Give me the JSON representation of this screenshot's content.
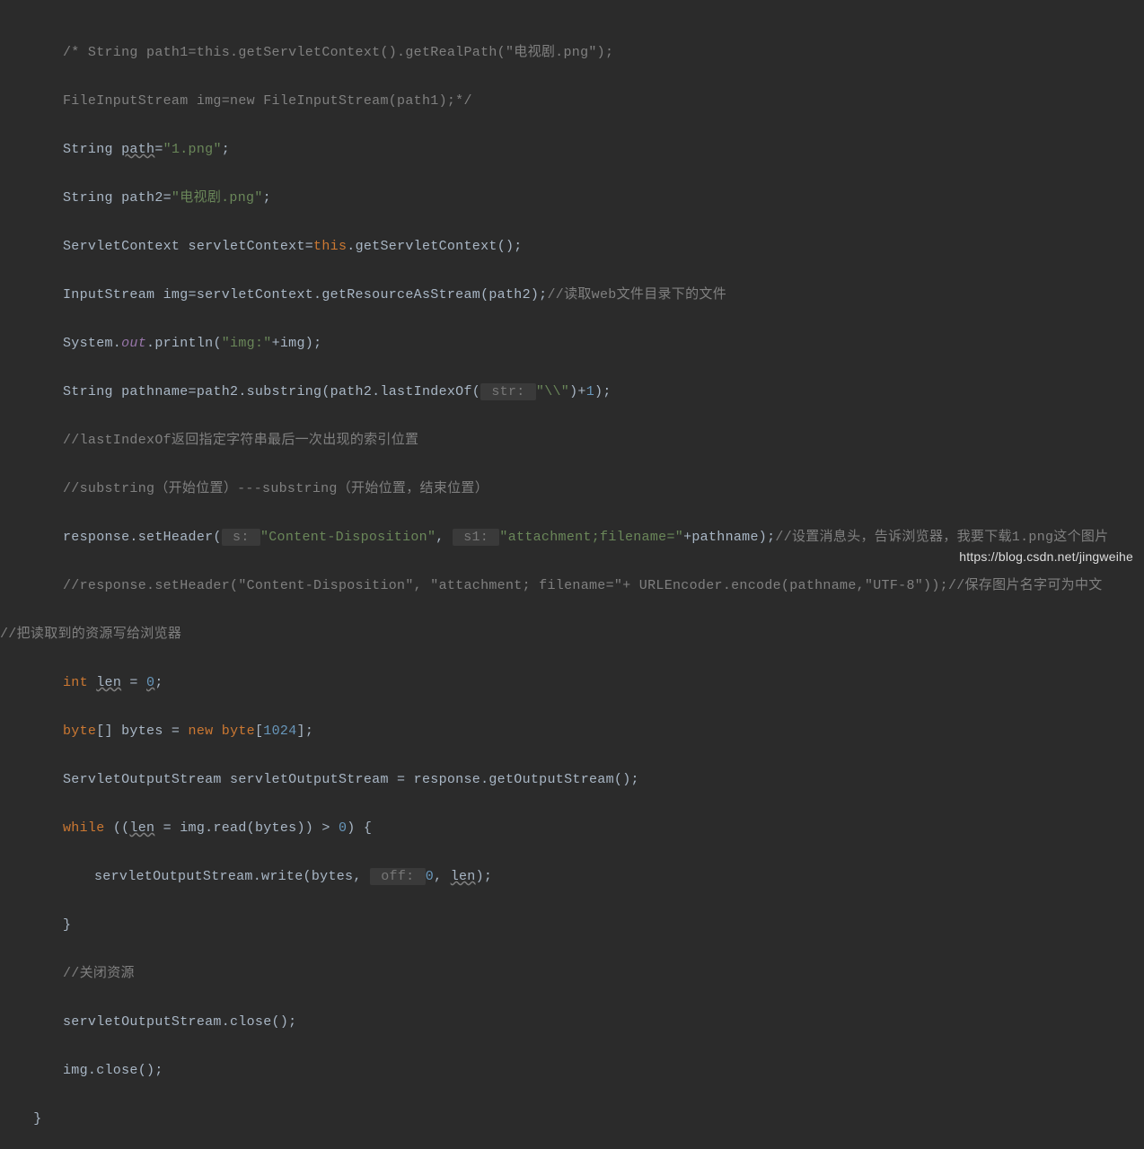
{
  "code": {
    "l1": "/* String path1=this.getServletContext().getRealPath(\"电视剧.png\");",
    "l2": "FileInputStream img=new FileInputStream(path1);*/",
    "l3_a": "String ",
    "l3_b": "path",
    "l3_c": "=",
    "l3_d": "\"1.png\"",
    "l3_e": ";",
    "l4_a": "String path2=",
    "l4_b": "\"电视剧.png\"",
    "l4_c": ";",
    "l5_a": "ServletContext servletContext=",
    "l5_b": "this",
    "l5_c": ".getServletContext();",
    "l6_a": "InputStream img=servletContext.getResourceAsStream(path2);",
    "l6_b": "//读取web文件目录下的文件",
    "l7_a": "System.",
    "l7_b": "out",
    "l7_c": ".println(",
    "l7_d": "\"img:\"",
    "l7_e": "+img);",
    "l8_a": "String pathname=path2.substring(path2.lastIndexOf(",
    "l8_hint": " str: ",
    "l8_b": "\"\\\\\"",
    "l8_c": ")+",
    "l8_d": "1",
    "l8_e": ");",
    "l9": "//lastIndexOf返回指定字符串最后一次出现的索引位置",
    "l10": "//substring（开始位置）---substring（开始位置，结束位置）",
    "l11_a": "response.setHeader(",
    "l11_h1": " s: ",
    "l11_b": "\"Content-Disposition\"",
    "l11_c": ", ",
    "l11_h2": " s1: ",
    "l11_d": "\"attachment;filename=\"",
    "l11_e": "+pathname);",
    "l11_f": "//设置消息头，告诉浏览器，我要下载1.png这个图片",
    "l12": "//response.setHeader(\"Content-Disposition\", \"attachment; filename=\"+ URLEncoder.encode(pathname,\"UTF-8\"));//保存图片名字可为中文",
    "l13": "//把读取到的资源写给浏览器",
    "l14_a": "int ",
    "l14_b": "len",
    "l14_c": " = ",
    "l14_d": "0",
    "l14_e": ";",
    "l15_a": "byte",
    "l15_b": "[] bytes = ",
    "l15_c": "new ",
    "l15_d": "byte",
    "l15_e": "[",
    "l15_f": "1024",
    "l15_g": "];",
    "l16": "ServletOutputStream servletOutputStream = response.getOutputStream();",
    "l17_a": "while ",
    "l17_b": "((",
    "l17_c": "len",
    "l17_d": " = img.read(bytes)) > ",
    "l17_e": "0",
    "l17_f": ") {",
    "l18_a": "servletOutputStream.write(bytes, ",
    "l18_h": " off: ",
    "l18_b": "0",
    "l18_c": ", ",
    "l18_d": "len",
    "l18_e": ");",
    "l19": "}",
    "l20": "//关闭资源",
    "l21": "servletOutputStream.close();",
    "l22": "img.close();",
    "l23": "}"
  },
  "watermark": "https://blog.csdn.net/jingweihe"
}
